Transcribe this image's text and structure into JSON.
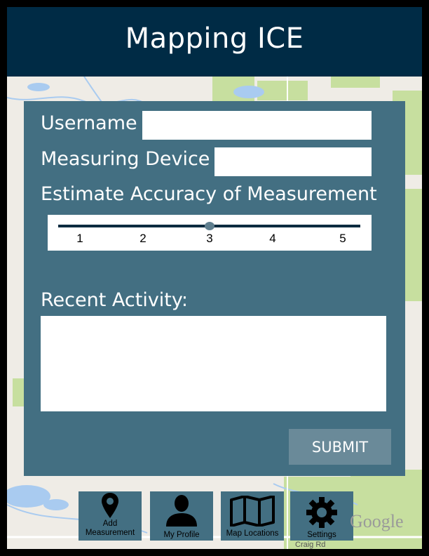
{
  "app": {
    "title": "Mapping ICE"
  },
  "form": {
    "username_label": "Username",
    "username_value": "",
    "device_label": "Measuring Device",
    "device_value": "",
    "accuracy_label": "Estimate Accuracy of Measurement",
    "accuracy_ticks": [
      "1",
      "2",
      "3",
      "4",
      "5"
    ],
    "accuracy_value": 3,
    "activity_label": "Recent Activity:",
    "activity_value": "",
    "submit_label": "SUBMIT"
  },
  "nav": {
    "items": [
      {
        "label_line1": "Add",
        "label_line2": "Measurement",
        "icon": "map-pin-icon"
      },
      {
        "label": "My Profile",
        "icon": "person-icon"
      },
      {
        "label": "Map Locations",
        "icon": "folded-map-icon"
      },
      {
        "label": "Settings",
        "icon": "gear-icon"
      }
    ]
  },
  "map": {
    "attribution": "Google",
    "road_label": "Craig Rd"
  },
  "colors": {
    "header": "#002b45",
    "panel": "#436f82",
    "submit": "#6a8a99",
    "map_land": "#efece6",
    "map_water": "#a9cbf0",
    "map_park": "#c7df9f"
  }
}
